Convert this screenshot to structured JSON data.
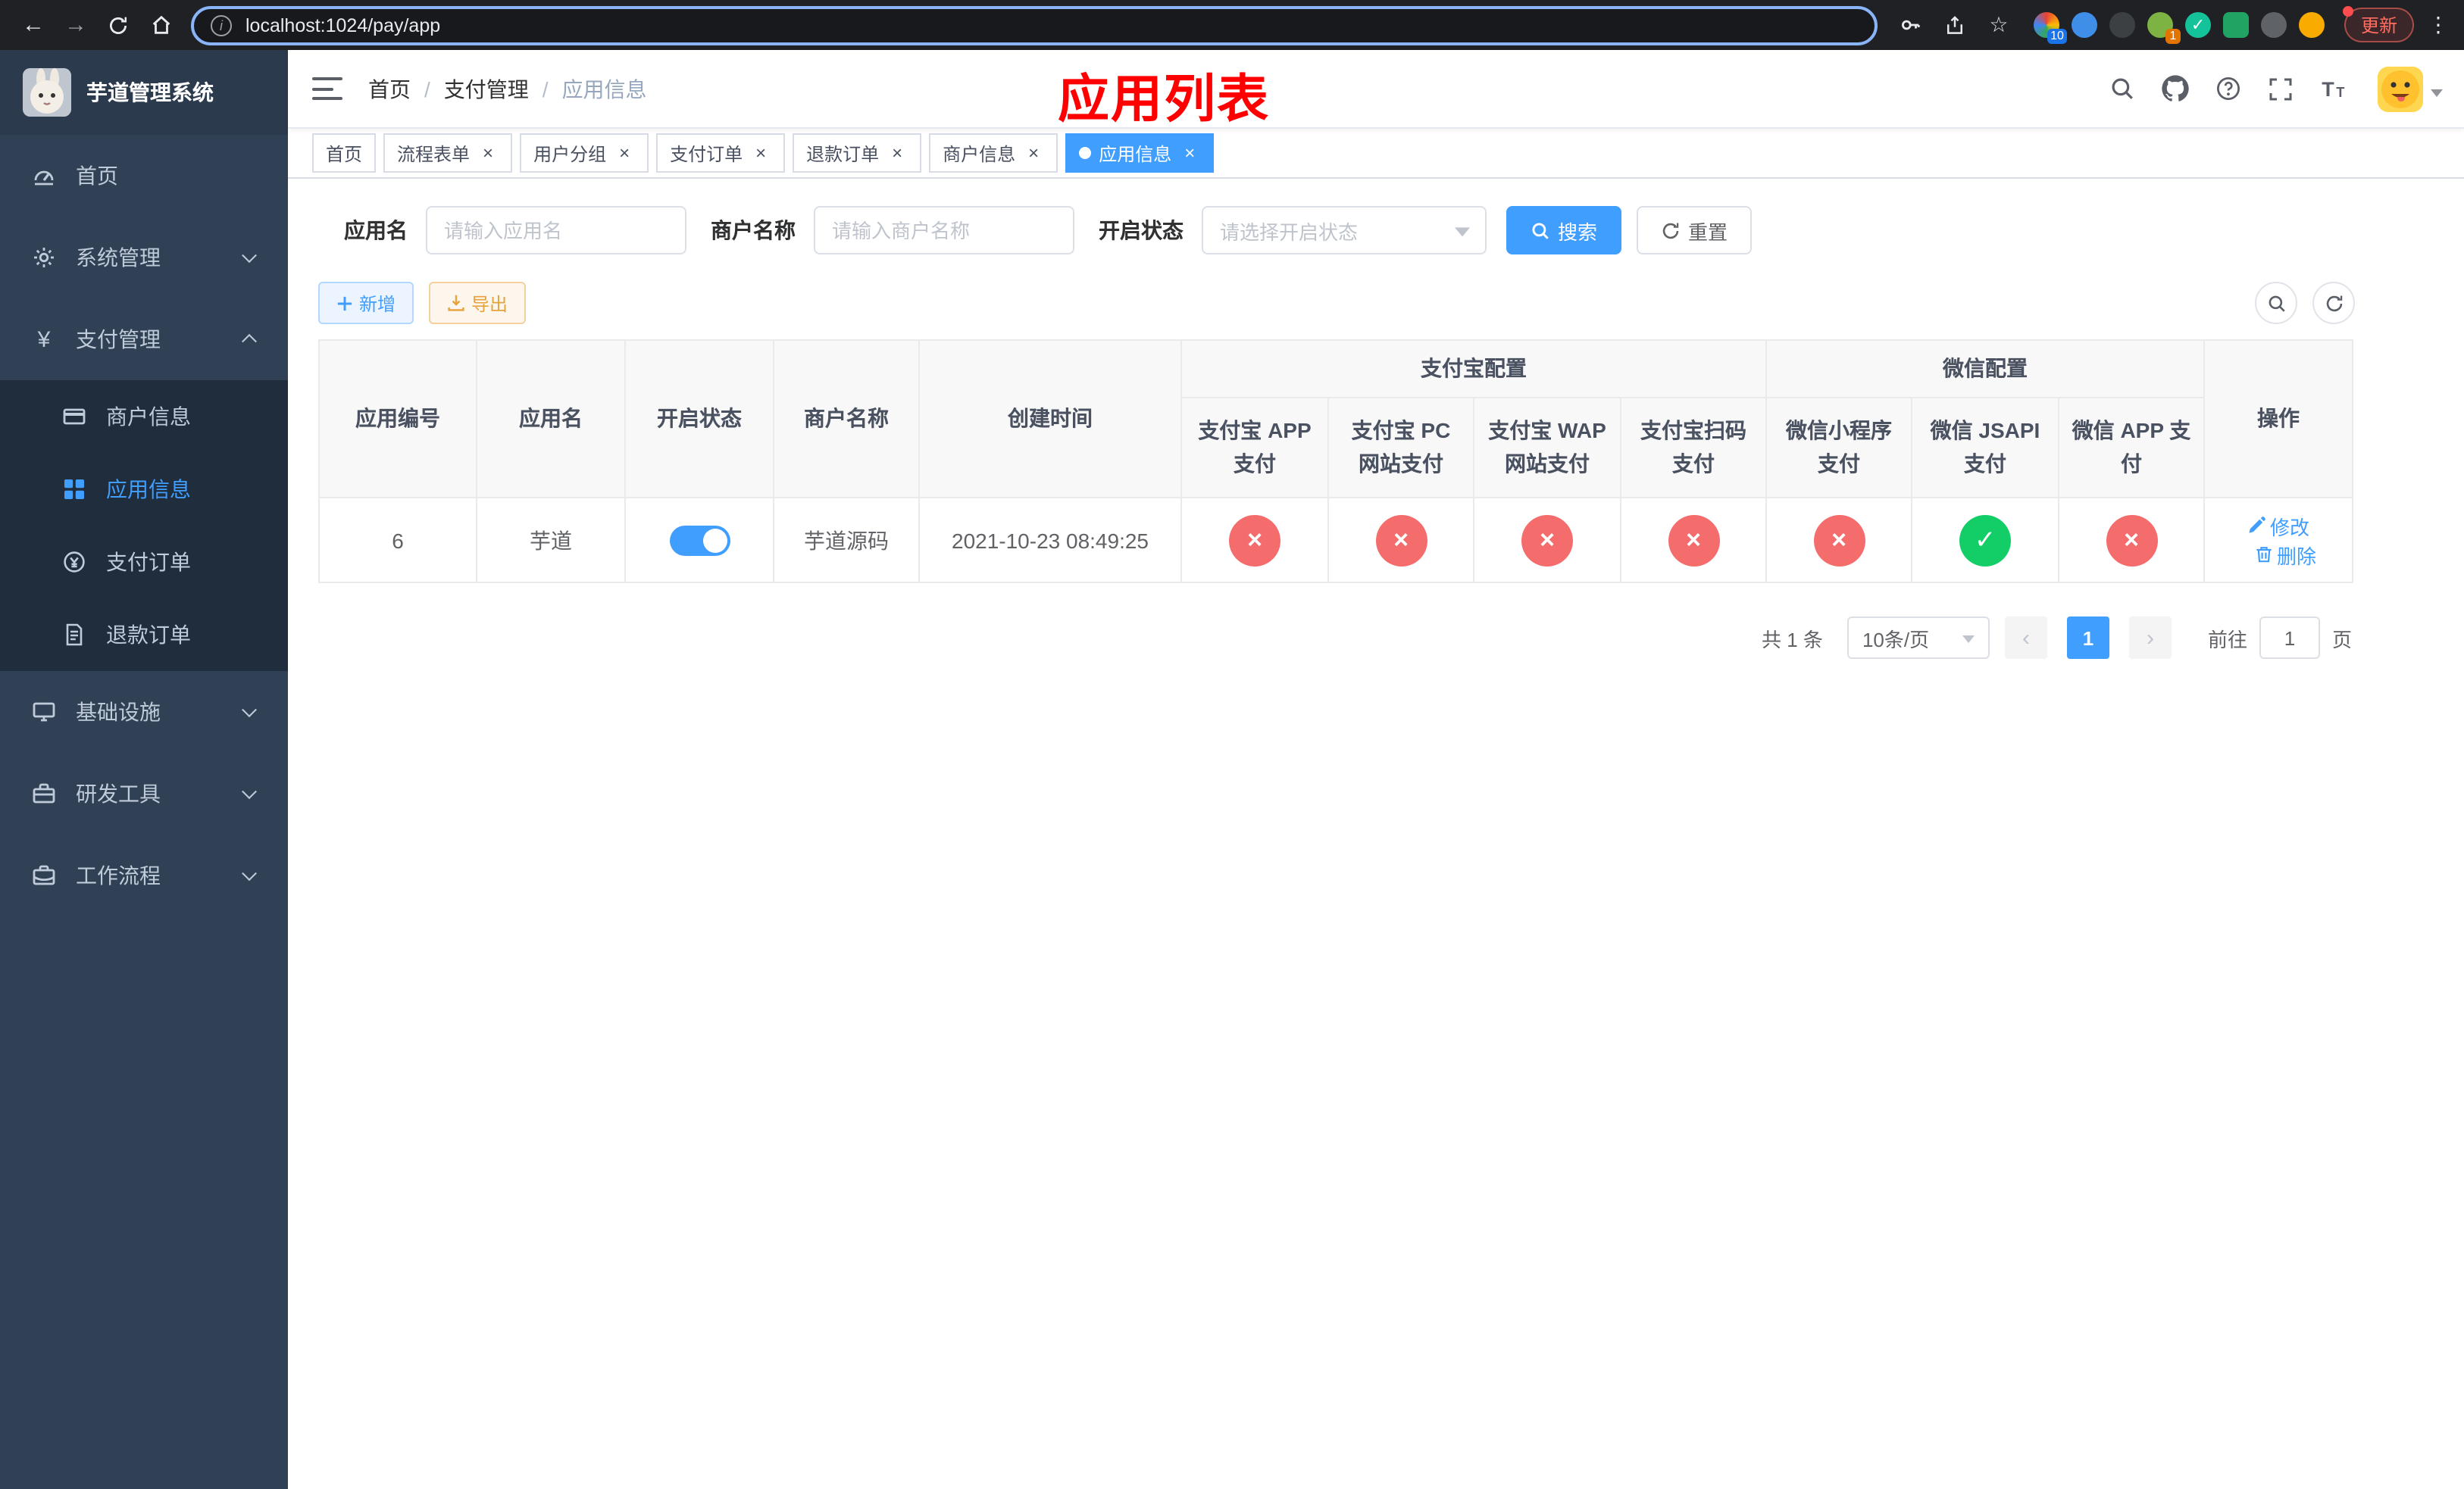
{
  "browser": {
    "url": "localhost:1024/pay/app",
    "update_label": "更新",
    "ext_badge_1": "10",
    "ext_badge_2": "1"
  },
  "sidebar": {
    "app_title": "芋道管理系统",
    "menu": [
      {
        "label": "首页",
        "icon": "dashboard-icon"
      },
      {
        "label": "系统管理",
        "icon": "gear-icon"
      },
      {
        "label": "支付管理",
        "icon": "yen-icon",
        "expanded": true
      },
      {
        "label": "商户信息",
        "icon": "card-icon"
      },
      {
        "label": "应用信息",
        "icon": "grid-icon",
        "active": true
      },
      {
        "label": "支付订单",
        "icon": "order-icon"
      },
      {
        "label": "退款订单",
        "icon": "refund-icon"
      },
      {
        "label": "基础设施",
        "icon": "infra-icon"
      },
      {
        "label": "研发工具",
        "icon": "tools-icon"
      },
      {
        "label": "工作流程",
        "icon": "workflow-icon"
      }
    ]
  },
  "header": {
    "breadcrumb": [
      "首页",
      "支付管理",
      "应用信息"
    ],
    "overlay_title": "应用列表"
  },
  "tabs": [
    {
      "label": "首页",
      "closable": false,
      "active": false
    },
    {
      "label": "流程表单",
      "closable": true,
      "active": false
    },
    {
      "label": "用户分组",
      "closable": true,
      "active": false
    },
    {
      "label": "支付订单",
      "closable": true,
      "active": false
    },
    {
      "label": "退款订单",
      "closable": true,
      "active": false
    },
    {
      "label": "商户信息",
      "closable": true,
      "active": false
    },
    {
      "label": "应用信息",
      "closable": true,
      "active": true
    }
  ],
  "filters": {
    "app_name_label": "应用名",
    "app_name_placeholder": "请输入应用名",
    "app_name_value": "",
    "merchant_label": "商户名称",
    "merchant_placeholder": "请输入商户名称",
    "merchant_value": "",
    "status_label": "开启状态",
    "status_placeholder": "请选择开启状态",
    "search_label": "搜索",
    "reset_label": "重置"
  },
  "toolbar": {
    "add_label": "新增",
    "export_label": "导出"
  },
  "table": {
    "headers": {
      "app_id": "应用编号",
      "app_name": "应用名",
      "status": "开启状态",
      "merchant": "商户名称",
      "created": "创建时间",
      "alipay_group": "支付宝配置",
      "alipay_cols": [
        "支付宝 APP 支付",
        "支付宝 PC 网站支付",
        "支付宝 WAP 网站支付",
        "支付宝扫码支付"
      ],
      "wechat_group": "微信配置",
      "wechat_cols": [
        "微信小程序支付",
        "微信 JSAPI 支付",
        "微信 APP 支付"
      ],
      "actions": "操作"
    },
    "rows": [
      {
        "id": "6",
        "name": "芋道",
        "status_on": true,
        "merchant": "芋道源码",
        "created": "2021-10-23 08:49:25",
        "configs": [
          false,
          false,
          false,
          false,
          false,
          true,
          false
        ],
        "edit_label": "修改",
        "delete_label": "删除"
      }
    ]
  },
  "pagination": {
    "total": "共 1 条",
    "page_size": "10条/页",
    "current_page": "1",
    "goto_prefix": "前往",
    "goto_value": "1",
    "goto_suffix": "页"
  },
  "colors": {
    "accent": "#409eff",
    "status_on": "#13ce66",
    "status_off": "#f56c6c",
    "title_red": "#ff0000"
  }
}
